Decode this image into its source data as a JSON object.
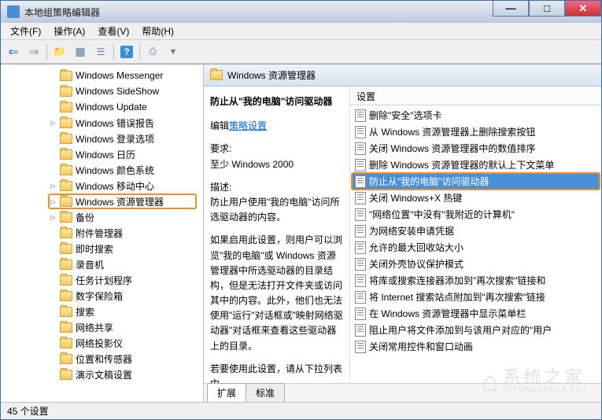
{
  "title": "本地组策略编辑器",
  "menus": {
    "file": "文件(F)",
    "action": "操作(A)",
    "view": "查看(V)",
    "help": "帮助(H)"
  },
  "tree": {
    "items": [
      {
        "label": "Windows Messenger",
        "expander": ""
      },
      {
        "label": "Windows SideShow",
        "expander": ""
      },
      {
        "label": "Windows Update",
        "expander": ""
      },
      {
        "label": "Windows 错误报告",
        "expander": "▷"
      },
      {
        "label": "Windows 登录选项",
        "expander": ""
      },
      {
        "label": "Windows 日历",
        "expander": ""
      },
      {
        "label": "Windows 颜色系统",
        "expander": ""
      },
      {
        "label": "Windows 移动中心",
        "expander": "▷"
      },
      {
        "label": "Windows 资源管理器",
        "expander": "▷",
        "selected": true
      },
      {
        "label": "备份",
        "expander": "▷"
      },
      {
        "label": "附件管理器",
        "expander": ""
      },
      {
        "label": "即时搜索",
        "expander": ""
      },
      {
        "label": "录音机",
        "expander": ""
      },
      {
        "label": "任务计划程序",
        "expander": ""
      },
      {
        "label": "数字保险箱",
        "expander": ""
      },
      {
        "label": "搜索",
        "expander": ""
      },
      {
        "label": "网络共享",
        "expander": ""
      },
      {
        "label": "网络投影仪",
        "expander": ""
      },
      {
        "label": "位置和传感器",
        "expander": ""
      },
      {
        "label": "演示文稿设置",
        "expander": ""
      }
    ]
  },
  "header_title": "Windows 资源管理器",
  "desc": {
    "title": "防止从\"我的电脑\"访问驱动器",
    "edit_prefix": "编辑",
    "edit_link": "策略设置",
    "req_label": "要求:",
    "req_text": "至少 Windows 2000",
    "desc_label": "描述:",
    "desc_text": "防止用户使用\"我的电脑\"访问所选驱动器的内容。",
    "p2": "如果启用此设置，则用户可以浏览\"我的电脑\"或 Windows 资源管理器中所选驱动器的目录结构，但是无法打开文件夹或访问其中的内容。此外，他们也无法使用\"运行\"对话框或\"映射网络驱动器\"对话框来查看这些驱动器上的目录。",
    "p3": "若要使用此设置，请从下拉列表中"
  },
  "settings_header": "设置",
  "settings": [
    "删除\"安全\"选项卡",
    "从 Windows 资源管理器上删除搜索按钮",
    "关闭 Windows 资源管理器中的数值排序",
    "删除 Windows 资源管理器的默认上下文菜单",
    "防止从\"我的电脑\"访问驱动器",
    "关闭 Windows+X 热键",
    "\"网络位置\"中没有\"我附近的计算机\"",
    "为网络安装申请凭据",
    "允许的最大回收站大小",
    "关闭外壳协议保护模式",
    "将库或搜索连接器添加到\"再次搜索\"链接和",
    "将 Internet 搜索站点附加到\"再次搜索\"链接",
    "在 Windows 资源管理器中显示菜单栏",
    "阻止用户将文件添加到与该用户对应的\"用户",
    "关闭常用控件和窗口动画"
  ],
  "settings_selected_index": 4,
  "tabs": {
    "extended": "扩展",
    "standard": "标准"
  },
  "status": "45 个设置",
  "watermark": {
    "cn": "系统之家",
    "en": "XITONGZHIJIA.NET"
  }
}
